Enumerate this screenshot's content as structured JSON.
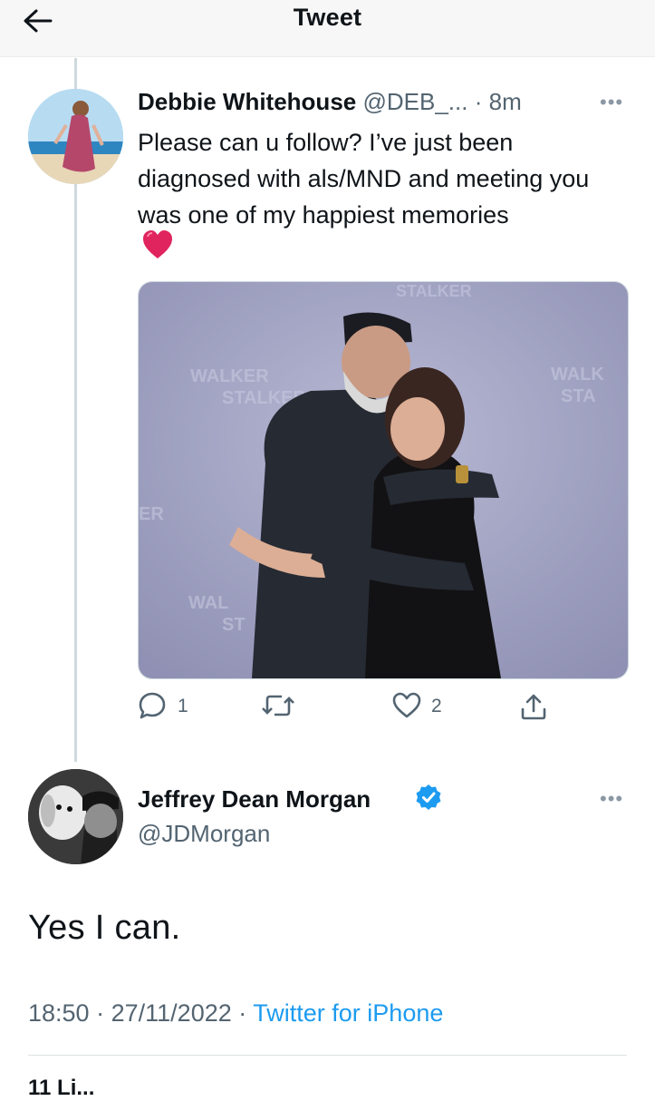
{
  "header": {
    "title": "Tweet",
    "back_icon": "arrow-left-icon"
  },
  "original_tweet": {
    "author_name": "Debbie Whitehouse",
    "handle": "@DEB_...",
    "separator": "·",
    "time": "8m",
    "text": "Please can u follow? I’ve just been diagnosed with als/MND and meeting you was one of my happiest memories",
    "emoji": "red-heart-emoji",
    "photo": {
      "description": "photo of two people hugging",
      "backdrop_texts": [
        "WALKER",
        "STALKER",
        "WALK",
        "STA",
        "WAL",
        "ST",
        "ER",
        "STALKER"
      ]
    },
    "actions": {
      "reply_count": "1",
      "retweet_count": "",
      "like_count": "2"
    }
  },
  "reply_tweet": {
    "author_name": "Jeffrey Dean Morgan",
    "handle": "@JDMorgan",
    "verified": true,
    "text": "Yes I can.",
    "time": "18:50",
    "date": "27/11/2022",
    "separator": "·",
    "source": "Twitter for iPhone",
    "peek": "11 Li..."
  },
  "colors": {
    "link": "#1d9bf0",
    "muted": "#536471",
    "verified": "#1d9bf0",
    "heart": "#e0245e"
  }
}
